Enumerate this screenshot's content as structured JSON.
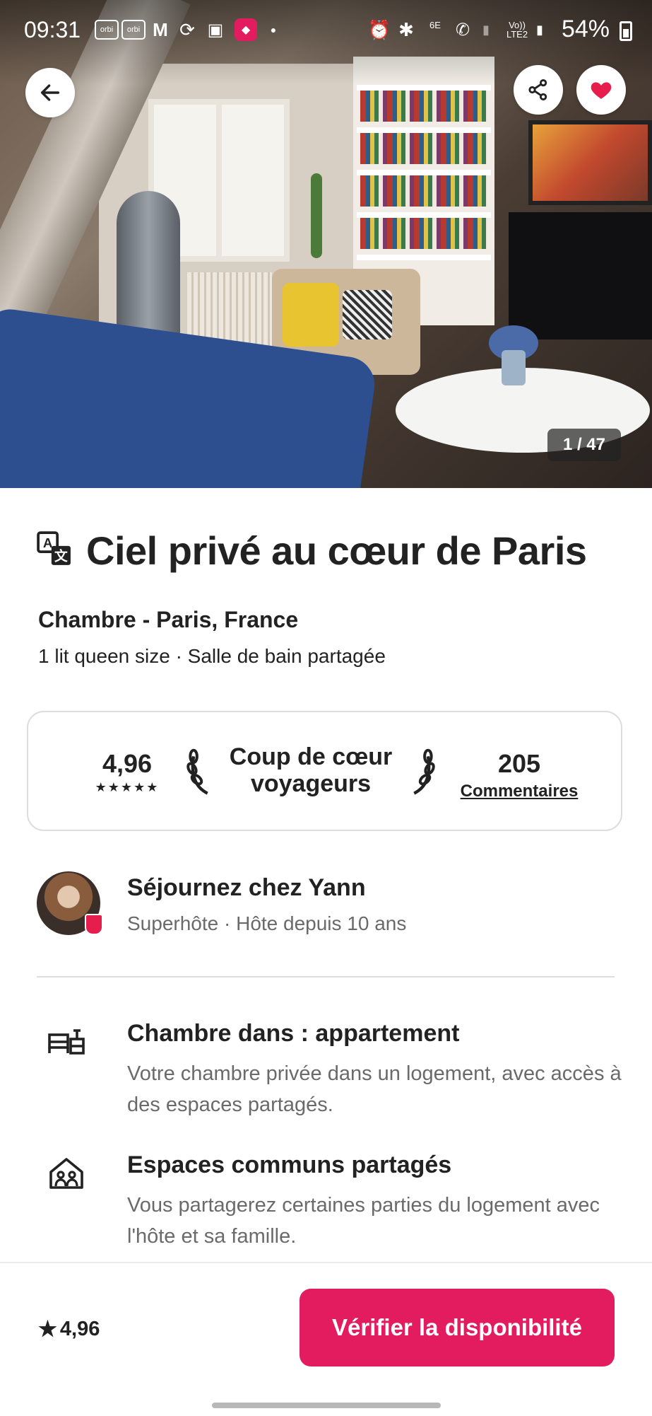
{
  "status_bar": {
    "time": "09:31",
    "battery": "54%",
    "network": "LTE2",
    "wifi": "6E"
  },
  "photo": {
    "counter": "1 / 47"
  },
  "listing": {
    "title": "Ciel privé au cœur de Paris",
    "type_location": "Chambre - Paris, France",
    "details": "1 lit queen size · Salle de bain partagée"
  },
  "rating_card": {
    "score": "4,96",
    "stars": "★★★★★",
    "badge_text": "Coup de cœur voyageurs",
    "badge_line1": "Coup de cœur",
    "badge_line2": "voyageurs",
    "reviews_count": "205",
    "reviews_label": "Commentaires"
  },
  "host": {
    "name": "Séjournez chez Yann",
    "subtitle": "Superhôte · Hôte depuis 10 ans"
  },
  "features": [
    {
      "title": "Chambre dans : appartement",
      "description": "Votre chambre privée dans un logement, avec accès à des espaces partagés.",
      "icon": "room-icon"
    },
    {
      "title": "Espaces communs partagés",
      "description": "Vous partagerez certaines parties du logement avec l'hôte et sa famille.",
      "icon": "home-shared-icon"
    }
  ],
  "bottom_bar": {
    "rating": "4,96",
    "cta": "Vérifier la disponibilité"
  },
  "colors": {
    "brand": "#e31c5f",
    "favorite": "#e61e4d",
    "text": "#222222",
    "muted": "#6a6a6a"
  }
}
